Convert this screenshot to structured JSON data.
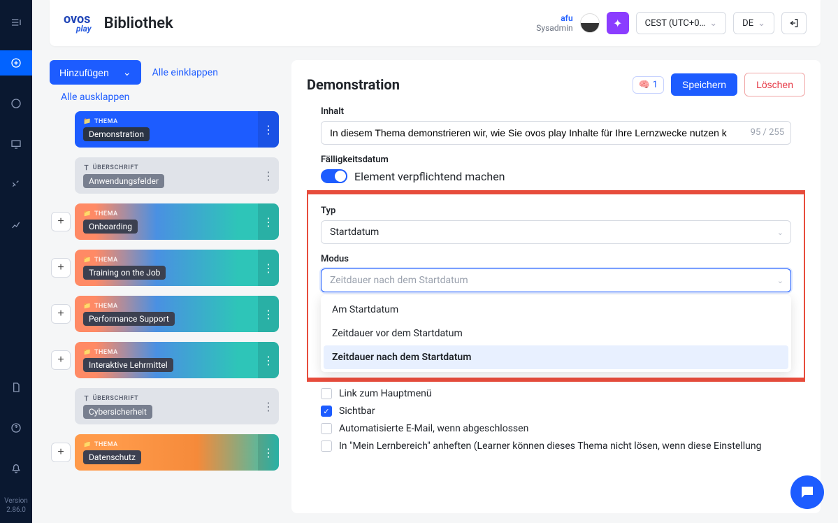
{
  "brand": {
    "name": "ovos",
    "sub": "play"
  },
  "page_title": "Bibliothek",
  "user": {
    "name": "afu",
    "role": "Sysadmin"
  },
  "header": {
    "timezone": "CEST (UTC+0…",
    "language": "DE"
  },
  "left": {
    "add_label": "Hinzufügen",
    "collapse_all": "Alle einklappen",
    "expand_all": "Alle ausklappen"
  },
  "tree": {
    "type_thema": "THEMA",
    "type_header": "ÜBERSCHRIFT",
    "items": [
      {
        "label": "Demonstration"
      },
      {
        "label": "Anwendungsfelder"
      },
      {
        "label": "Onboarding"
      },
      {
        "label": "Training on the Job"
      },
      {
        "label": "Performance Support"
      },
      {
        "label": "Interaktive Lehrmittel"
      },
      {
        "label": "Cybersicherheit"
      },
      {
        "label": "Datenschutz"
      }
    ]
  },
  "panel": {
    "title": "Demonstration",
    "counter": "1",
    "save": "Speichern",
    "delete": "Löschen"
  },
  "form": {
    "content_label": "Inhalt",
    "content_value": "In diesem Thema demonstrieren wir, wie Sie ovos play Inhalte für Ihre Lernzwecke nutzen k",
    "content_count": "95 / 255",
    "due_label": "Fälligkeitsdatum",
    "mandatory_text": "Element verpflichtend machen",
    "type_label": "Typ",
    "type_value": "Startdatum",
    "mode_label": "Modus",
    "mode_placeholder": "Zeitdauer nach dem Startdatum",
    "mode_options": {
      "o1": "Am Startdatum",
      "o2": "Zeitdauer vor dem Startdatum",
      "o3": "Zeitdauer nach dem Startdatum"
    },
    "menu_link": "Link zum Hauptmenü",
    "visible": "Sichtbar",
    "auto_email": "Automatisierte E-Mail, wenn abgeschlossen",
    "pin_text": "In \"Mein Lernbereich\" anheften (Learner können dieses Thema nicht lösen, wenn diese Einstellung"
  },
  "version": {
    "l1": "Version",
    "l2": "2.86.0"
  }
}
